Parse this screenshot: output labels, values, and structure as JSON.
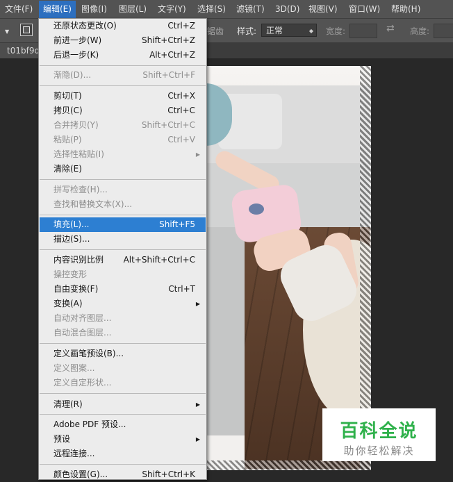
{
  "menubar": {
    "items": [
      {
        "label": "文件(F)"
      },
      {
        "label": "编辑(E)"
      },
      {
        "label": "图像(I)"
      },
      {
        "label": "图层(L)"
      },
      {
        "label": "文字(Y)"
      },
      {
        "label": "选择(S)"
      },
      {
        "label": "滤镜(T)"
      },
      {
        "label": "3D(D)"
      },
      {
        "label": "视图(V)"
      },
      {
        "label": "窗口(W)"
      },
      {
        "label": "帮助(H)"
      }
    ],
    "active_index": 1
  },
  "options_bar": {
    "feather_tail": "锯齿",
    "style_label": "样式:",
    "style_value": "正常",
    "width_label": "宽度:",
    "height_label": "高度:"
  },
  "document": {
    "tab_title": "t01bf9d"
  },
  "edit_menu": {
    "items": [
      {
        "label": "还原状态更改(O)",
        "shortcut": "Ctrl+Z",
        "enabled": true
      },
      {
        "label": "前进一步(W)",
        "shortcut": "Shift+Ctrl+Z",
        "enabled": true
      },
      {
        "label": "后退一步(K)",
        "shortcut": "Alt+Ctrl+Z",
        "enabled": true
      },
      {
        "label": "渐隐(D)...",
        "shortcut": "Shift+Ctrl+F",
        "enabled": false
      },
      {
        "label": "剪切(T)",
        "shortcut": "Ctrl+X",
        "enabled": true
      },
      {
        "label": "拷贝(C)",
        "shortcut": "Ctrl+C",
        "enabled": true
      },
      {
        "label": "合并拷贝(Y)",
        "shortcut": "Shift+Ctrl+C",
        "enabled": false
      },
      {
        "label": "粘贴(P)",
        "shortcut": "Ctrl+V",
        "enabled": false
      },
      {
        "label": "选择性粘贴(I)",
        "shortcut": "",
        "enabled": false,
        "submenu": true
      },
      {
        "label": "清除(E)",
        "shortcut": "",
        "enabled": true
      },
      {
        "label": "拼写检查(H)...",
        "shortcut": "",
        "enabled": false
      },
      {
        "label": "查找和替换文本(X)...",
        "shortcut": "",
        "enabled": false
      },
      {
        "label": "填充(L)...",
        "shortcut": "Shift+F5",
        "enabled": true,
        "highlighted": true
      },
      {
        "label": "描边(S)...",
        "shortcut": "",
        "enabled": true
      },
      {
        "label": "内容识别比例",
        "shortcut": "Alt+Shift+Ctrl+C",
        "enabled": true
      },
      {
        "label": "操控变形",
        "shortcut": "",
        "enabled": false
      },
      {
        "label": "自由变换(F)",
        "shortcut": "Ctrl+T",
        "enabled": true
      },
      {
        "label": "变换(A)",
        "shortcut": "",
        "enabled": true,
        "submenu": true
      },
      {
        "label": "自动对齐图层...",
        "shortcut": "",
        "enabled": false
      },
      {
        "label": "自动混合图层...",
        "shortcut": "",
        "enabled": false
      },
      {
        "label": "定义画笔预设(B)...",
        "shortcut": "",
        "enabled": true
      },
      {
        "label": "定义图案...",
        "shortcut": "",
        "enabled": false
      },
      {
        "label": "定义自定形状...",
        "shortcut": "",
        "enabled": false
      },
      {
        "label": "清理(R)",
        "shortcut": "",
        "enabled": true,
        "submenu": true
      },
      {
        "label": "Adobe PDF 预设...",
        "shortcut": "",
        "enabled": true
      },
      {
        "label": "预设",
        "shortcut": "",
        "enabled": true,
        "submenu": true
      },
      {
        "label": "远程连接...",
        "shortcut": "",
        "enabled": true
      },
      {
        "label": "颜色设置(G)...",
        "shortcut": "Shift+Ctrl+K",
        "enabled": true
      }
    ]
  },
  "watermark": {
    "title": "百科全说",
    "subtitle": "助你轻松解决"
  },
  "colors": {
    "menu_highlight": "#2d7fd2",
    "menubar_active": "#2d6fbf",
    "watermark_green": "#2fb14b"
  }
}
